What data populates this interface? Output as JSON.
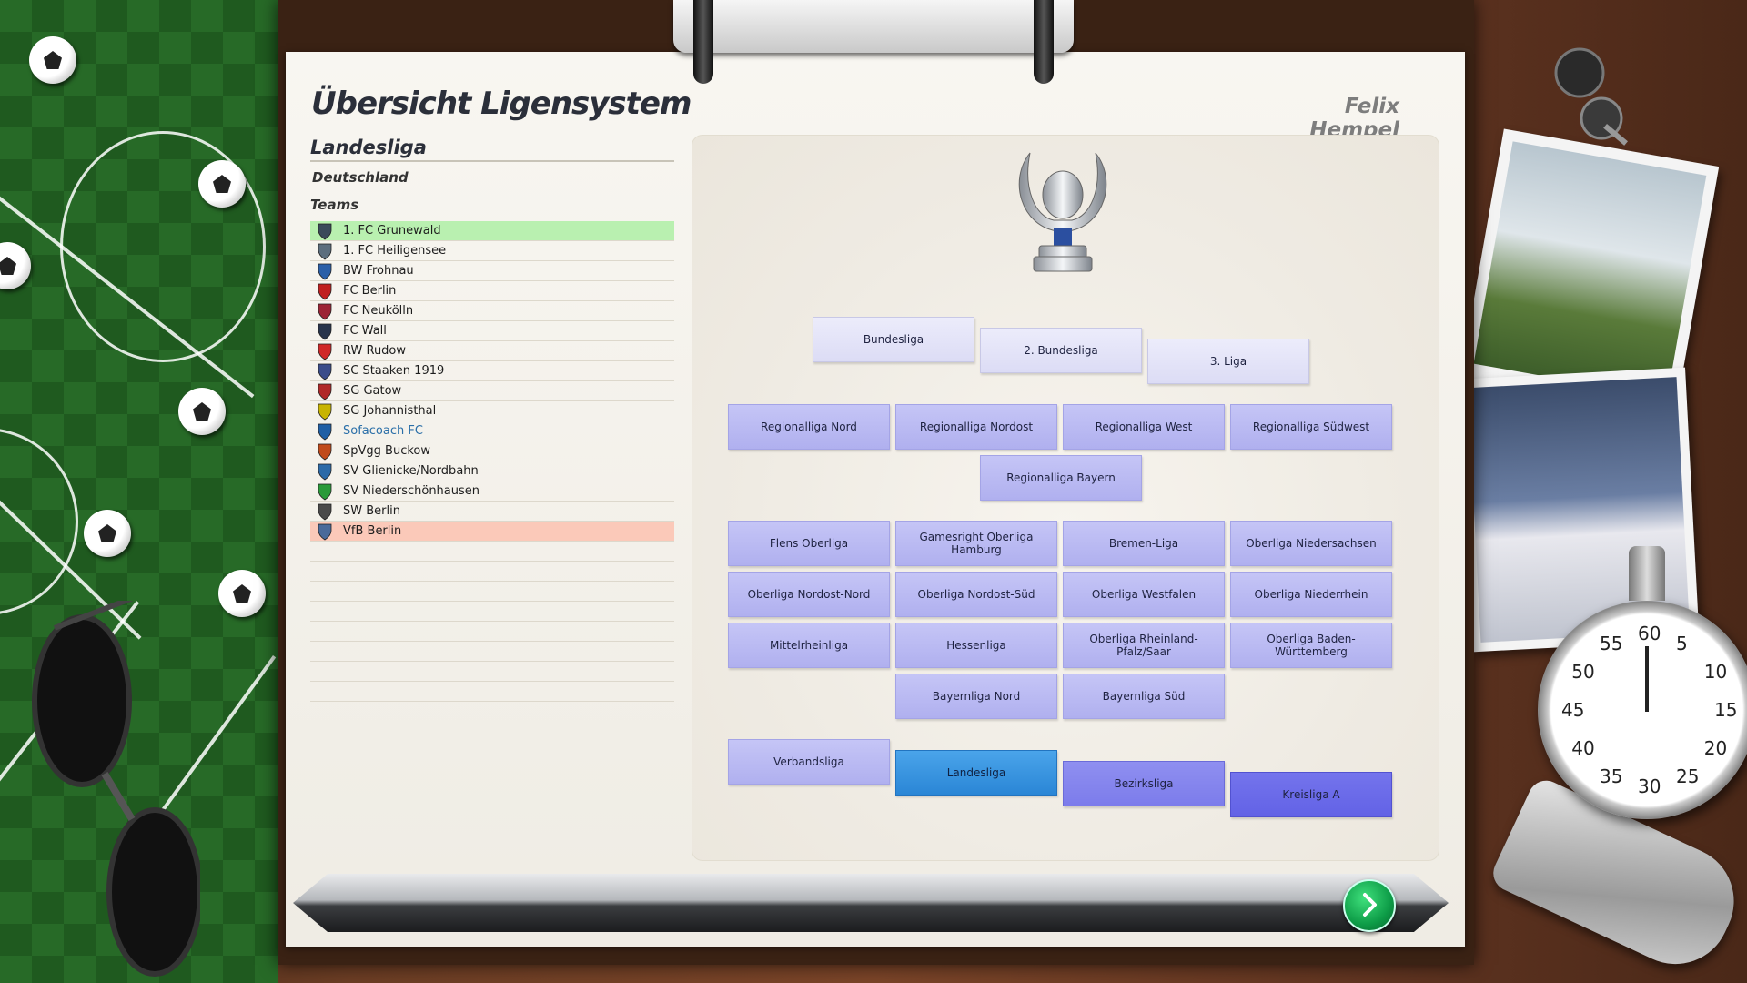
{
  "header": {
    "title": "Übersicht Ligensystem",
    "manager": "Felix Hempel"
  },
  "league": {
    "name": "Landesliga",
    "country": "Deutschland",
    "teams_heading": "Teams"
  },
  "teams": [
    {
      "name": "1. FC Grunewald",
      "highlight": "green",
      "crest_color": "#3a4a5a"
    },
    {
      "name": "1. FC Heiligensee",
      "highlight": "none",
      "crest_color": "#5c6e7e"
    },
    {
      "name": "BW Frohnau",
      "highlight": "none",
      "crest_color": "#2b5fa8"
    },
    {
      "name": "FC Berlin",
      "highlight": "none",
      "crest_color": "#c02020"
    },
    {
      "name": "FC Neukölln",
      "highlight": "none",
      "crest_color": "#9c2436"
    },
    {
      "name": "FC Wall",
      "highlight": "none",
      "crest_color": "#28344c"
    },
    {
      "name": "RW Rudow",
      "highlight": "none",
      "crest_color": "#d02828"
    },
    {
      "name": "SC Staaken 1919",
      "highlight": "none",
      "crest_color": "#3a4c8a"
    },
    {
      "name": "SG Gatow",
      "highlight": "none",
      "crest_color": "#b02828"
    },
    {
      "name": "SG Johannisthal",
      "highlight": "none",
      "crest_color": "#c8b400"
    },
    {
      "name": "Sofacoach FC",
      "highlight": "own",
      "crest_color": "#1f5fa5"
    },
    {
      "name": "SpVgg Buckow",
      "highlight": "none",
      "crest_color": "#c04a1a"
    },
    {
      "name": "SV Glienicke/Nordbahn",
      "highlight": "none",
      "crest_color": "#2c6aa8"
    },
    {
      "name": "SV Niederschönhausen",
      "highlight": "none",
      "crest_color": "#2a9a3a"
    },
    {
      "name": "SW Berlin",
      "highlight": "none",
      "crest_color": "#4a4a4a"
    },
    {
      "name": "VfB Berlin",
      "highlight": "red",
      "crest_color": "#4a6a9a"
    }
  ],
  "pyramid": [
    {
      "label": "Bundesliga",
      "level": "top"
    },
    {
      "label": "2. Bundesliga",
      "level": "top"
    },
    {
      "label": "3. Liga",
      "level": "top"
    },
    {
      "label": "Regionalliga Nord",
      "level": "mid"
    },
    {
      "label": "Regionalliga Nordost",
      "level": "mid"
    },
    {
      "label": "Regionalliga West",
      "level": "mid"
    },
    {
      "label": "Regionalliga Südwest",
      "level": "mid"
    },
    {
      "label": "Regionalliga Bayern",
      "level": "mid"
    },
    {
      "label": "Flens Oberliga",
      "level": "mid"
    },
    {
      "label": "Gamesright Oberliga Hamburg",
      "level": "mid"
    },
    {
      "label": "Bremen-Liga",
      "level": "mid"
    },
    {
      "label": "Oberliga Niedersachsen",
      "level": "mid"
    },
    {
      "label": "Oberliga Nordost-Nord",
      "level": "mid"
    },
    {
      "label": "Oberliga Nordost-Süd",
      "level": "mid"
    },
    {
      "label": "Oberliga Westfalen",
      "level": "mid"
    },
    {
      "label": "Oberliga Niederrhein",
      "level": "mid"
    },
    {
      "label": "Mittelrheinliga",
      "level": "mid"
    },
    {
      "label": "Hessenliga",
      "level": "mid"
    },
    {
      "label": "Oberliga Rheinland-Pfalz/Saar",
      "level": "mid"
    },
    {
      "label": "Oberliga Baden-Württemberg",
      "level": "mid"
    },
    {
      "label": "Bayernliga Nord",
      "level": "mid"
    },
    {
      "label": "Bayernliga Süd",
      "level": "mid"
    },
    {
      "label": "Verbandsliga",
      "level": "mid"
    },
    {
      "label": "Landesliga",
      "level": "current"
    },
    {
      "label": "Bezirksliga",
      "level": "low"
    },
    {
      "label": "Kreisliga A",
      "level": "lower"
    }
  ],
  "stopwatch": {
    "labels": [
      "60",
      "5",
      "10",
      "15",
      "20",
      "25",
      "30",
      "35",
      "40",
      "45",
      "50",
      "55"
    ]
  },
  "colors": {
    "accent_green": "#1aa552",
    "highlight_green": "#b9f0b0",
    "highlight_red": "#fbc9b9",
    "own_team": "#2a6fa8"
  },
  "icons": {
    "next": "chevron-right-icon",
    "trophy": "trophy-icon"
  }
}
